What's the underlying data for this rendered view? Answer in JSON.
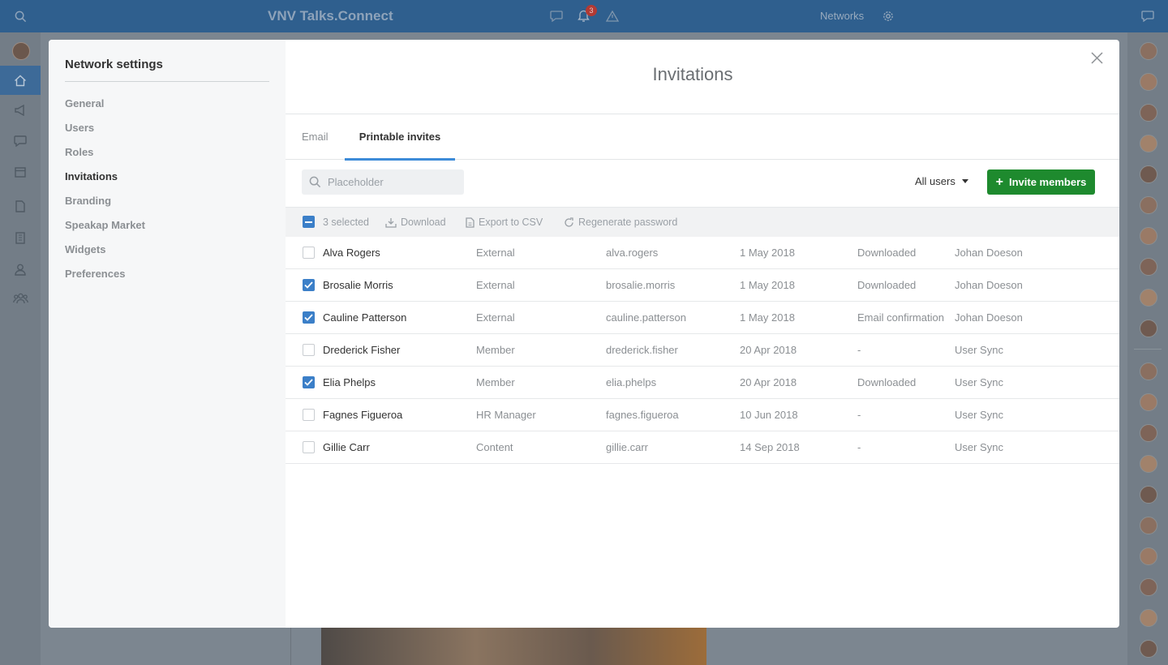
{
  "app": {
    "title": "VNV Talks.Connect",
    "notification_count": "3",
    "networks_label": "Networks"
  },
  "left_rail": {
    "items": [
      "home-icon",
      "megaphone-icon",
      "chat-icon",
      "calendar-icon",
      "document-icon",
      "building-icon",
      "person-icon",
      "group-icon"
    ],
    "active": "home-icon"
  },
  "right_rail": {
    "contact_count": 20
  },
  "settings": {
    "title": "Network settings",
    "nav": [
      {
        "label": "General"
      },
      {
        "label": "Users"
      },
      {
        "label": "Roles"
      },
      {
        "label": "Invitations",
        "active": true
      },
      {
        "label": "Branding"
      },
      {
        "label": "Speakap Market"
      },
      {
        "label": "Widgets"
      },
      {
        "label": "Preferences"
      }
    ]
  },
  "main": {
    "title": "Invitations",
    "tabs": {
      "email": "Email",
      "printable": "Printable invites",
      "active": "printable"
    },
    "search": {
      "placeholder": "Placeholder",
      "value": ""
    },
    "filter": {
      "selected": "All users"
    },
    "invite_button": {
      "label": "Invite members"
    },
    "bulk": {
      "selected_label": "3 selected",
      "download": "Download",
      "export": "Export to CSV",
      "regenerate": "Regenerate password"
    },
    "rows": [
      {
        "checked": false,
        "name": "Alva Rogers",
        "role": "External",
        "username": "alva.rogers",
        "date": "1 May 2018",
        "status": "Downloaded",
        "by": "Johan Doeson"
      },
      {
        "checked": true,
        "name": "Brosalie Morris",
        "role": "External",
        "username": "brosalie.morris",
        "date": "1 May 2018",
        "status": "Downloaded",
        "by": "Johan Doeson"
      },
      {
        "checked": true,
        "name": "Cauline Patterson",
        "role": "External",
        "username": "cauline.patterson",
        "date": "1 May 2018",
        "status": "Email confirmation",
        "by": "Johan Doeson"
      },
      {
        "checked": false,
        "name": "Drederick Fisher",
        "role": "Member",
        "username": "drederick.fisher",
        "date": "20 Apr 2018",
        "status": "-",
        "by": "User Sync"
      },
      {
        "checked": true,
        "name": "Elia Phelps",
        "role": "Member",
        "username": "elia.phelps",
        "date": "20 Apr 2018",
        "status": "Downloaded",
        "by": "User Sync"
      },
      {
        "checked": false,
        "name": "Fagnes Figueroa",
        "role": "HR Manager",
        "username": "fagnes.figueroa",
        "date": "10 Jun 2018",
        "status": "-",
        "by": "User Sync"
      },
      {
        "checked": false,
        "name": "Gillie Carr",
        "role": "Content",
        "username": "gillie.carr",
        "date": "14 Sep 2018",
        "status": "-",
        "by": "User Sync"
      }
    ]
  },
  "colors": {
    "topbar": "#2f5f8e",
    "accent_blue": "#3b7fc8",
    "tab_underline": "#3d8bd8",
    "invite_green": "#1e8a2e",
    "notification_red": "#b23a34"
  }
}
